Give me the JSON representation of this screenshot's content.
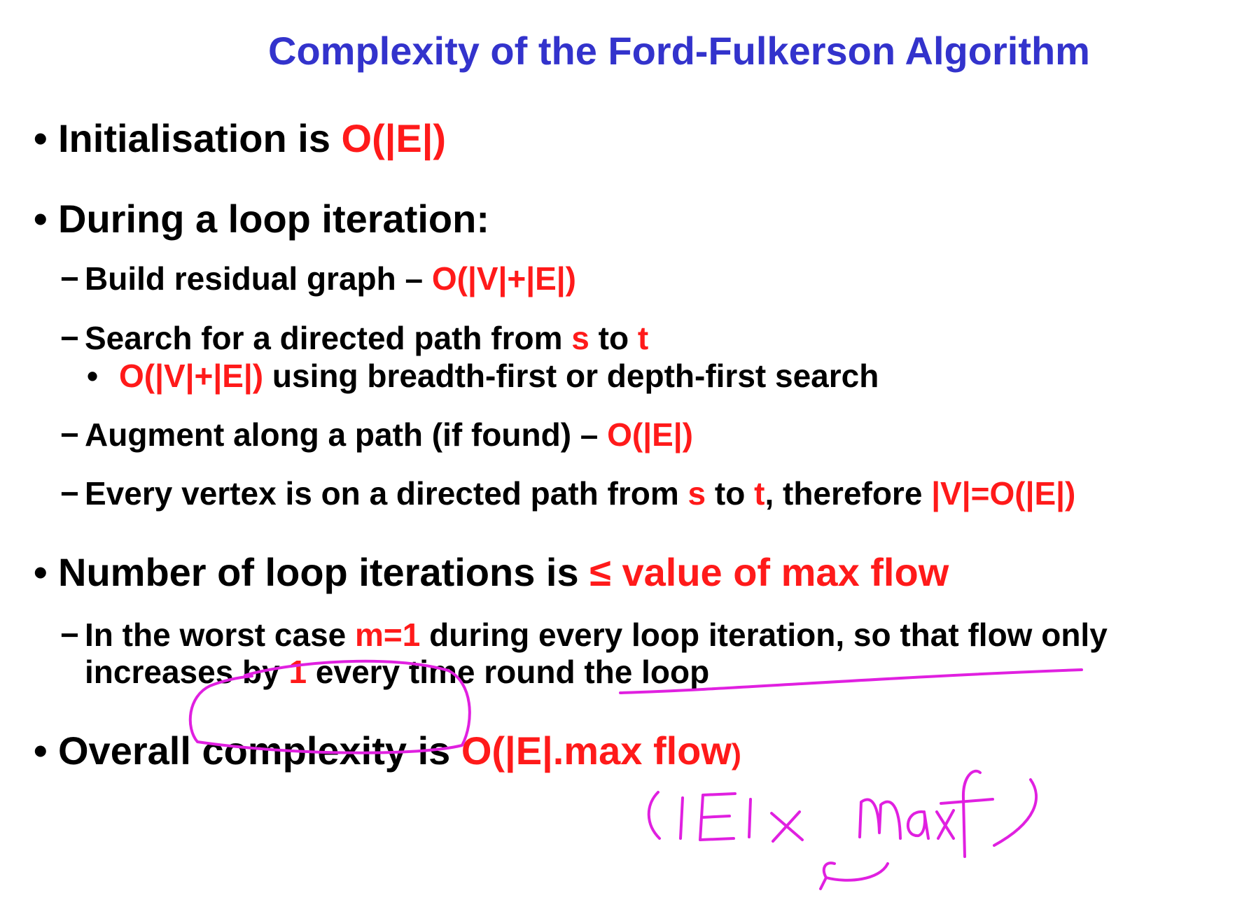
{
  "title": "Complexity of the Ford-Fulkerson Algorithm",
  "bullet_char": "•",
  "dash_char": "−",
  "sub_bullet_char": "•",
  "init": {
    "text": "Initialisation is ",
    "complexity": "O(|E|)"
  },
  "loop": {
    "heading": "During a loop iteration:",
    "residual": {
      "text": "Build residual graph – ",
      "complexity": "O(|V|+|E|)"
    },
    "search": {
      "t1": "Search for a directed path from ",
      "s": "s",
      "t2": " to ",
      "t": "t",
      "sub_complexity": "O(|V|+|E|)",
      "sub_text": " using breadth-first or depth-first search"
    },
    "augment": {
      "text": "Augment along a path (if found) – ",
      "complexity": "O(|E|)"
    },
    "vertex": {
      "t1": "Every vertex is on a directed path from ",
      "s": "s",
      "t2": " to ",
      "t": "t",
      "t3": ", therefore ",
      "rel": "|V|=O(|E|)"
    }
  },
  "iterations": {
    "text": "Number of loop iterations is ",
    "bound": "≤ value of max flow",
    "worst_line1": {
      "t1": "In the worst case ",
      "m": "m=1",
      "t2": " during every loop iteration, so that flow only"
    },
    "worst_line2": {
      "t1": "increases by ",
      "one": "1",
      "t2": " every time round the loop"
    }
  },
  "overall": {
    "text": "Overall complexity is ",
    "complexity": "O(|E|.max flow",
    "close": ")"
  },
  "annotation": {
    "color": "#e020e0",
    "handwriting": "(|E| x maxf)"
  }
}
